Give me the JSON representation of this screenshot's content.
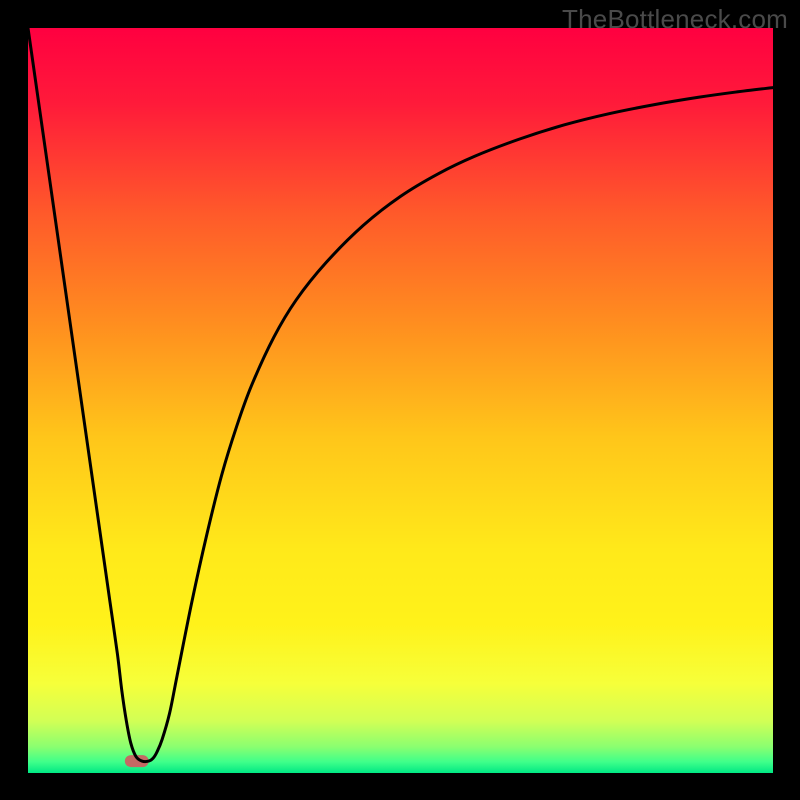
{
  "watermark": "TheBottleneck.com",
  "chart_data": {
    "type": "line",
    "title": "",
    "xlabel": "",
    "ylabel": "",
    "xlim": [
      0,
      100
    ],
    "ylim": [
      0,
      100
    ],
    "grid": false,
    "legend": false,
    "background_gradient": {
      "stops": [
        {
          "offset": 0.0,
          "color": "#ff0040"
        },
        {
          "offset": 0.1,
          "color": "#ff1a3a"
        },
        {
          "offset": 0.25,
          "color": "#ff5a2a"
        },
        {
          "offset": 0.4,
          "color": "#ff8f1f"
        },
        {
          "offset": 0.55,
          "color": "#ffc61a"
        },
        {
          "offset": 0.7,
          "color": "#ffe91a"
        },
        {
          "offset": 0.8,
          "color": "#fff21a"
        },
        {
          "offset": 0.88,
          "color": "#f6ff3a"
        },
        {
          "offset": 0.93,
          "color": "#d2ff55"
        },
        {
          "offset": 0.965,
          "color": "#8aff70"
        },
        {
          "offset": 0.985,
          "color": "#40ff8a"
        },
        {
          "offset": 1.0,
          "color": "#00e884"
        }
      ]
    },
    "series": [
      {
        "name": "bottleneck-curve",
        "stroke": "#000000",
        "x": [
          0,
          2,
          4,
          6,
          8,
          10,
          11,
          12,
          12.6,
          13.2,
          13.8,
          14.5,
          15.3,
          16.2,
          16.8,
          17.3,
          18,
          19,
          20,
          22,
          24,
          26,
          28,
          30,
          33,
          36,
          40,
          45,
          50,
          55,
          60,
          66,
          72,
          78,
          84,
          90,
          95,
          100
        ],
        "y": [
          100,
          86,
          72,
          58,
          44,
          30,
          23,
          16,
          11,
          7,
          4,
          2.2,
          1.6,
          1.6,
          2.0,
          2.8,
          4.5,
          8,
          13,
          23,
          32,
          40,
          46.5,
          52,
          58.5,
          63.5,
          68.5,
          73.5,
          77.4,
          80.4,
          82.8,
          85.1,
          87.0,
          88.5,
          89.7,
          90.7,
          91.4,
          92.0
        ]
      }
    ],
    "markers": [
      {
        "name": "ideal-range-marker",
        "type": "rounded-bar",
        "x_start": 13.0,
        "x_end": 16.2,
        "y": 1.6,
        "color": "#c46a64",
        "thickness_px": 12,
        "radius_px": 6
      }
    ]
  }
}
